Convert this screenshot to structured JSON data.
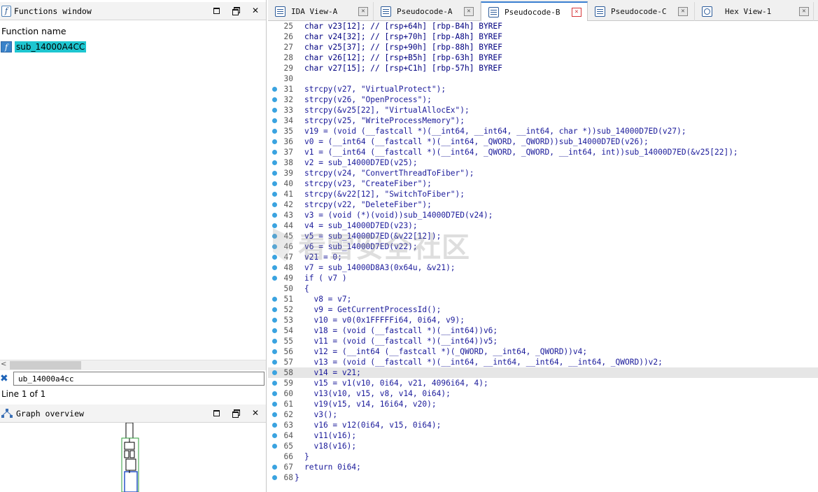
{
  "functions_window": {
    "title": "Functions window",
    "column_header": "Function name",
    "items": [
      {
        "name": "sub_14000A4CC"
      }
    ],
    "filter_value": "ub_14000a4cc",
    "line_info": "Line 1 of 1"
  },
  "graph_overview": {
    "title": "Graph overview"
  },
  "tabs": [
    {
      "label": "IDA View-A",
      "active": false,
      "icon": "listing-icon"
    },
    {
      "label": "Pseudocode-A",
      "active": false,
      "icon": "pseudocode-icon"
    },
    {
      "label": "Pseudocode-B",
      "active": true,
      "icon": "pseudocode-icon"
    },
    {
      "label": "Pseudocode-C",
      "active": false,
      "icon": "pseudocode-icon"
    },
    {
      "label": "Hex View-1",
      "active": false,
      "icon": "hex-icon"
    }
  ],
  "code_lines": [
    {
      "n": "25",
      "t": "char v23[12]; // [rsp+64h] [rbp-B4h] BYREF",
      "dot": false
    },
    {
      "n": "26",
      "t": "char v24[32]; // [rsp+70h] [rbp-A8h] BYREF",
      "dot": false
    },
    {
      "n": "27",
      "t": "char v25[37]; // [rsp+90h] [rbp-88h] BYREF",
      "dot": false
    },
    {
      "n": "28",
      "t": "char v26[12]; // [rsp+B5h] [rbp-63h] BYREF",
      "dot": false
    },
    {
      "n": "29",
      "t": "char v27[15]; // [rsp+C1h] [rbp-57h] BYREF",
      "dot": false
    },
    {
      "n": "30",
      "t": "",
      "dot": false
    },
    {
      "n": "31",
      "t": "strcpy(v27, \"VirtualProtect\");",
      "dot": true
    },
    {
      "n": "32",
      "t": "strcpy(v26, \"OpenProcess\");",
      "dot": true
    },
    {
      "n": "33",
      "t": "strcpy(&v25[22], \"VirtualAllocEx\");",
      "dot": true
    },
    {
      "n": "34",
      "t": "strcpy(v25, \"WriteProcessMemory\");",
      "dot": true
    },
    {
      "n": "35",
      "t": "v19 = (void (__fastcall *)(__int64, __int64, __int64, char *))sub_14000D7ED(v27);",
      "dot": true
    },
    {
      "n": "36",
      "t": "v0 = (__int64 (__fastcall *)(__int64, _QWORD, _QWORD))sub_14000D7ED(v26);",
      "dot": true
    },
    {
      "n": "37",
      "t": "v1 = (__int64 (__fastcall *)(__int64, _QWORD, _QWORD, __int64, int))sub_14000D7ED(&v25[22]);",
      "dot": true
    },
    {
      "n": "38",
      "t": "v2 = sub_14000D7ED(v25);",
      "dot": true
    },
    {
      "n": "39",
      "t": "strcpy(v24, \"ConvertThreadToFiber\");",
      "dot": true
    },
    {
      "n": "40",
      "t": "strcpy(v23, \"CreateFiber\");",
      "dot": true
    },
    {
      "n": "41",
      "t": "strcpy(&v22[12], \"SwitchToFiber\");",
      "dot": true
    },
    {
      "n": "42",
      "t": "strcpy(v22, \"DeleteFiber\");",
      "dot": true
    },
    {
      "n": "43",
      "t": "v3 = (void (*)(void))sub_14000D7ED(v24);",
      "dot": true
    },
    {
      "n": "44",
      "t": "v4 = sub_14000D7ED(v23);",
      "dot": true
    },
    {
      "n": "45",
      "t": "v5 = sub_14000D7ED(&v22[12]);",
      "dot": true
    },
    {
      "n": "46",
      "t": "v6 = sub_14000D7ED(v22);",
      "dot": true
    },
    {
      "n": "47",
      "t": "v21 = 0;",
      "dot": true
    },
    {
      "n": "48",
      "t": "v7 = sub_14000D8A3(0x64u, &v21);",
      "dot": true
    },
    {
      "n": "49",
      "t": "if ( v7 )",
      "dot": true
    },
    {
      "n": "50",
      "t": "{",
      "dot": false
    },
    {
      "n": "51",
      "t": "  v8 = v7;",
      "dot": true
    },
    {
      "n": "52",
      "t": "  v9 = GetCurrentProcessId();",
      "dot": true
    },
    {
      "n": "53",
      "t": "  v10 = v0(0x1FFFFFi64, 0i64, v9);",
      "dot": true
    },
    {
      "n": "54",
      "t": "  v18 = (void (__fastcall *)(__int64))v6;",
      "dot": true
    },
    {
      "n": "55",
      "t": "  v11 = (void (__fastcall *)(__int64))v5;",
      "dot": true
    },
    {
      "n": "56",
      "t": "  v12 = (__int64 (__fastcall *)(_QWORD, __int64, _QWORD))v4;",
      "dot": true
    },
    {
      "n": "57",
      "t": "  v13 = (void (__fastcall *)(__int64, __int64, __int64, __int64, _QWORD))v2;",
      "dot": true
    },
    {
      "n": "58",
      "t": "  v14 = v21;",
      "dot": true
    },
    {
      "n": "59",
      "t": "  v15 = v1(v10, 0i64, v21, 4096i64, 4);",
      "dot": true
    },
    {
      "n": "60",
      "t": "  v13(v10, v15, v8, v14, 0i64);",
      "dot": true
    },
    {
      "n": "61",
      "t": "  v19(v15, v14, 16i64, v20);",
      "dot": true
    },
    {
      "n": "62",
      "t": "  v3();",
      "dot": true
    },
    {
      "n": "63",
      "t": "  v16 = v12(0i64, v15, 0i64);",
      "dot": true
    },
    {
      "n": "64",
      "t": "  v11(v16);",
      "dot": true
    },
    {
      "n": "65",
      "t": "  v18(v16);",
      "dot": true
    },
    {
      "n": "66",
      "t": "}",
      "dot": false
    },
    {
      "n": "67",
      "t": "return 0i64;",
      "dot": true
    },
    {
      "n": "68",
      "t": "}",
      "dot": true,
      "outdent": true
    }
  ],
  "highlighted_line": "58",
  "colors": {
    "accent": "#3a7fd0",
    "breakpoint_dot": "#3aa3e0",
    "selection": "#1ec6d0",
    "code_text": "#1a1a9a"
  }
}
